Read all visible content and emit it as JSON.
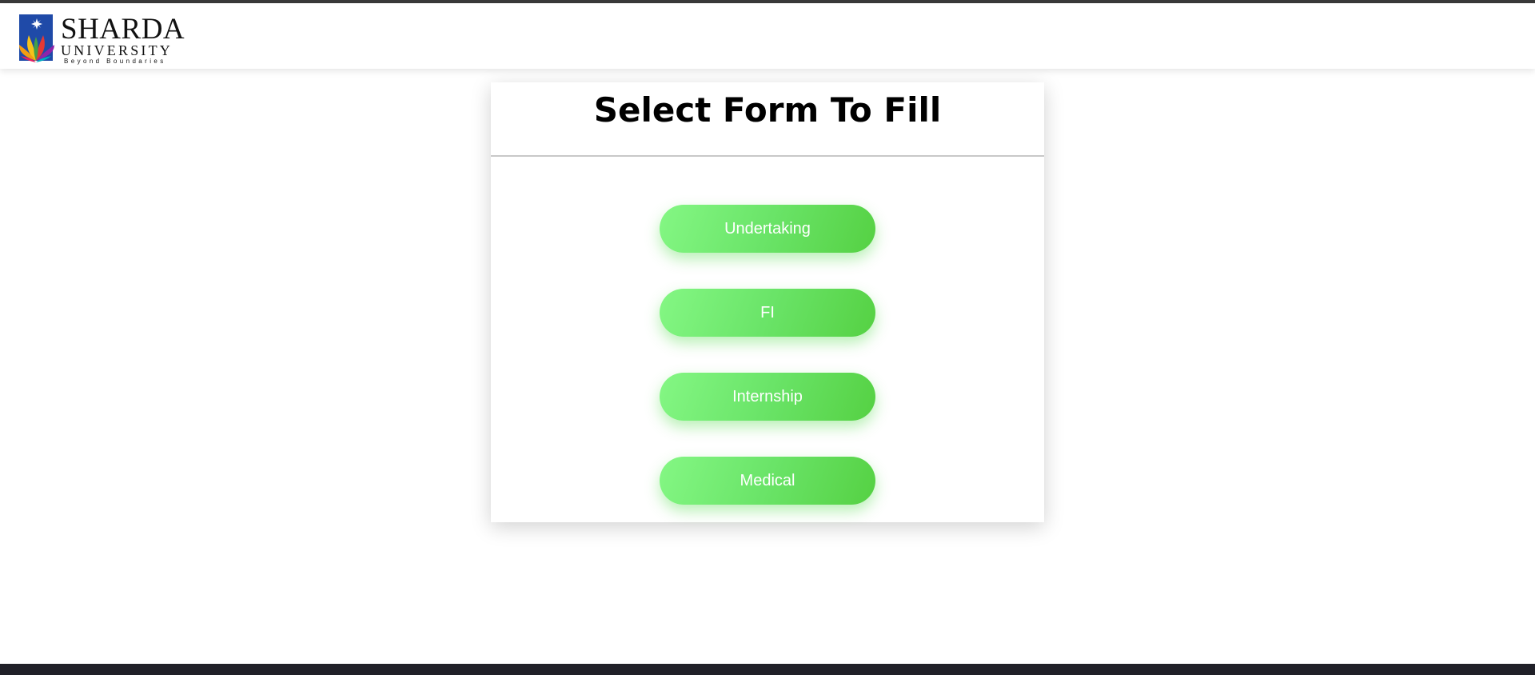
{
  "header": {
    "logo": {
      "title": "SHARDA",
      "subtitle": "UNIVERSITY",
      "tagline": "Beyond Boundaries"
    }
  },
  "form_select": {
    "title": "Select Form To Fill",
    "buttons": [
      {
        "label": "Undertaking"
      },
      {
        "label": "FI"
      },
      {
        "label": "Internship"
      },
      {
        "label": "Medical"
      }
    ]
  },
  "colors": {
    "button_gradient_start": "#84f784",
    "button_gradient_end": "#55d143",
    "logo_blue": "#1f4aa8"
  }
}
